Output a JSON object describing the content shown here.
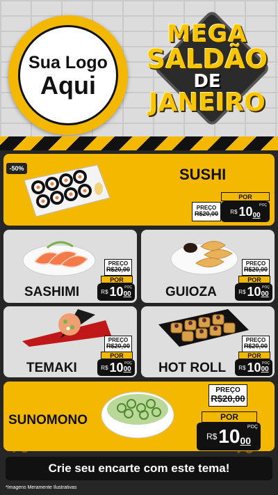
{
  "logo": {
    "line1": "Sua Logo",
    "line2": "Aqui"
  },
  "promo": {
    "w1": "MEGA",
    "w2": "SALDÃO",
    "w3": "DE",
    "w4": "JANEIRO"
  },
  "discount_tag": "-50%",
  "products": [
    {
      "name": "SUSHI",
      "preco_label": "PREÇO",
      "old_price": "R$20,00",
      "por_label": "POR",
      "currency": "R$",
      "price_int": "10",
      "price_cents": "00",
      "unit": "POÇ"
    },
    {
      "name": "SASHIMI",
      "preco_label": "PREÇO",
      "old_price": "R$20,00",
      "por_label": "POR",
      "currency": "R$",
      "price_int": "10",
      "price_cents": "00",
      "unit": "POÇ"
    },
    {
      "name": "GUIOZA",
      "preco_label": "PREÇO",
      "old_price": "R$20,00",
      "por_label": "POR",
      "currency": "R$",
      "price_int": "10",
      "price_cents": "00",
      "unit": "POÇ"
    },
    {
      "name": "TEMAKI",
      "preco_label": "PREÇO",
      "old_price": "R$20,00",
      "por_label": "POR",
      "currency": "R$",
      "price_int": "10",
      "price_cents": "00",
      "unit": "POÇ"
    },
    {
      "name": "HOT ROLL",
      "preco_label": "PREÇO",
      "old_price": "R$20,00",
      "por_label": "POR",
      "currency": "R$",
      "price_int": "10",
      "price_cents": "00",
      "unit": "POÇ"
    },
    {
      "name": "SUNOMONO",
      "preco_label": "PREÇO",
      "old_price": "R$20,00",
      "por_label": "POR",
      "currency": "R$",
      "price_int": "10",
      "price_cents": "00",
      "unit": "POÇ"
    }
  ],
  "banner": "Crie seu encarte com este tema!",
  "footnote": "*Imagens Meramente Ilustrativas",
  "colors": {
    "accent": "#f5b800",
    "dark": "#111111",
    "card_grey": "#dedede"
  }
}
